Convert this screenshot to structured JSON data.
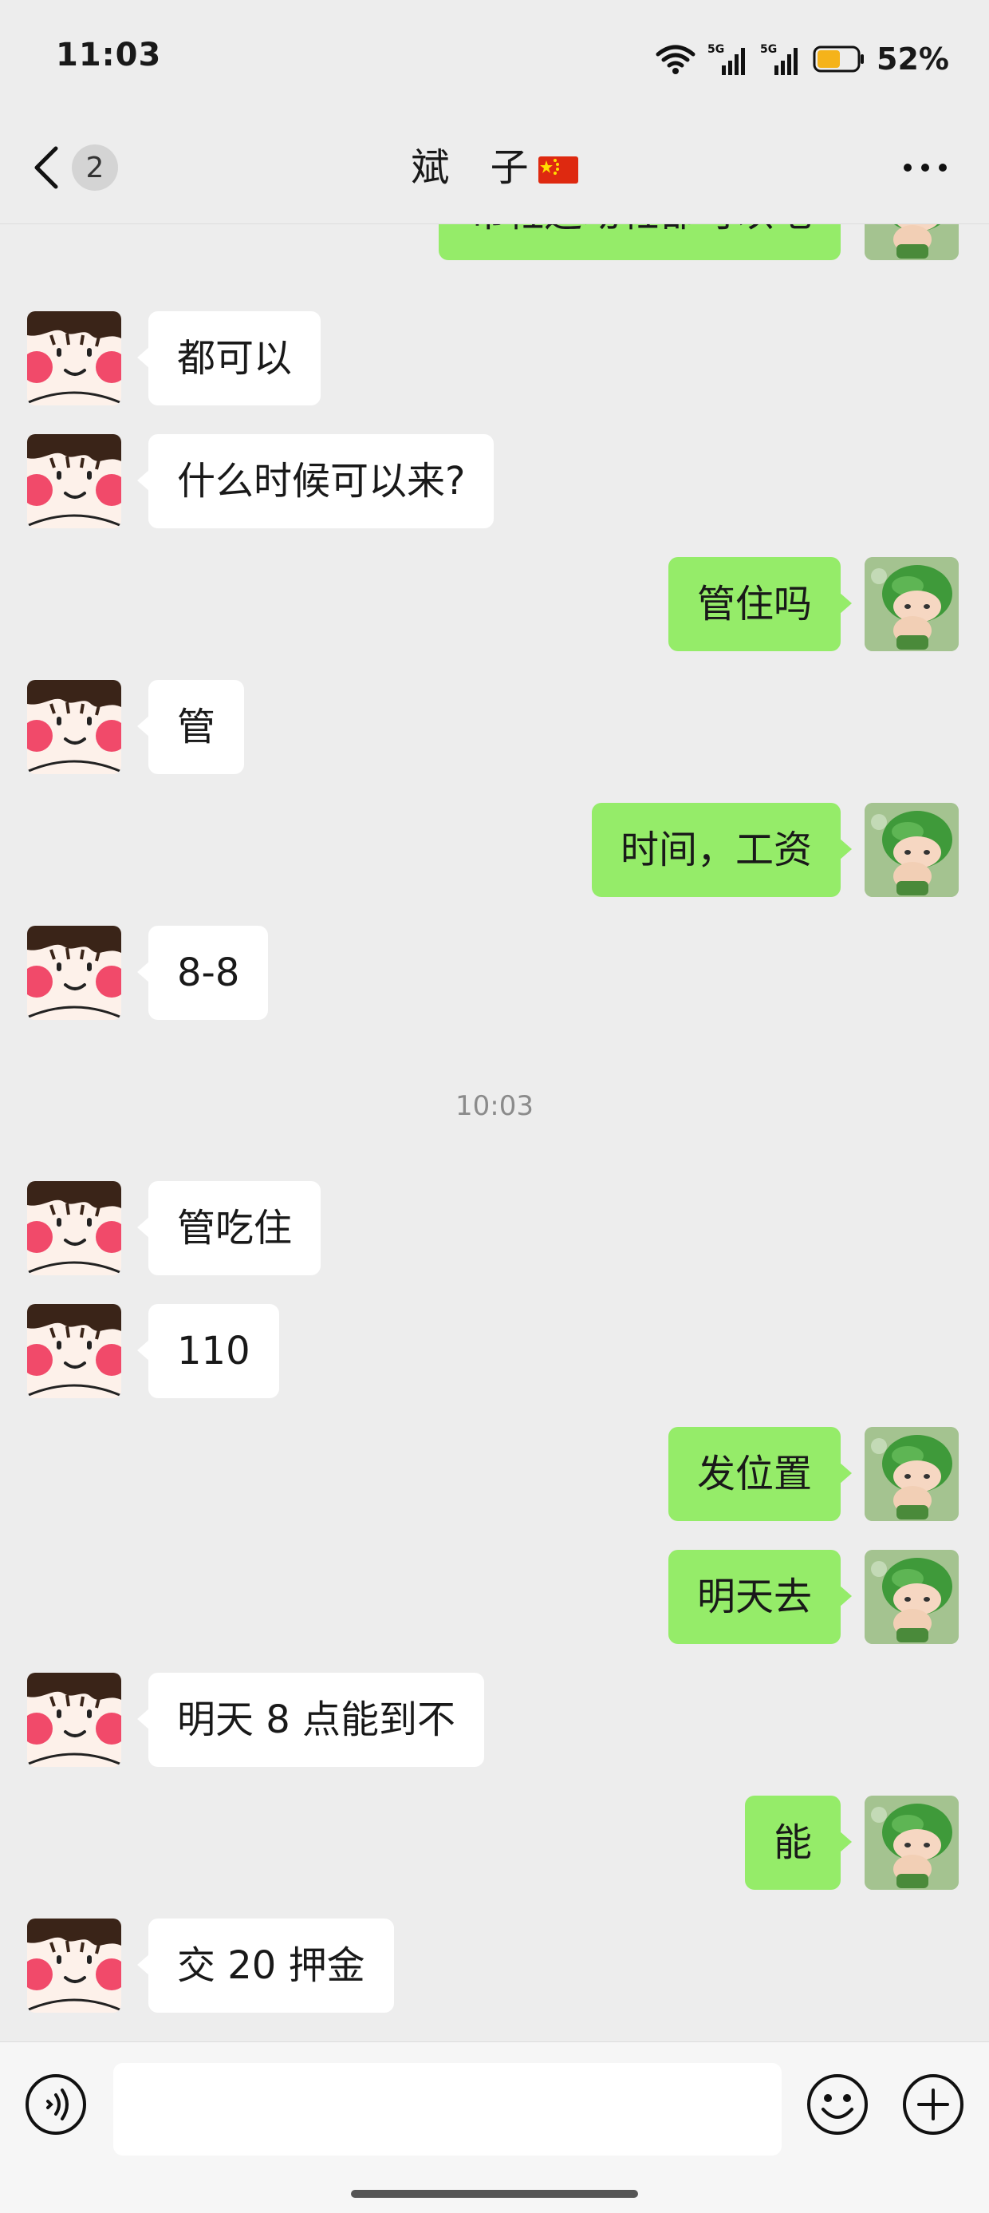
{
  "status_bar": {
    "time": "11:03",
    "battery": "52%",
    "network": "5G"
  },
  "header": {
    "unread_count": "2",
    "contact_name": "斌 子"
  },
  "messages": [
    {
      "side": "right",
      "text": "布鞋运动鞋都可以吧"
    },
    {
      "side": "left",
      "text": "都可以"
    },
    {
      "side": "left",
      "text": "什么时候可以来?"
    },
    {
      "side": "right",
      "text": "管住吗"
    },
    {
      "side": "left",
      "text": "管"
    },
    {
      "side": "right",
      "text": "时间，工资"
    },
    {
      "side": "left",
      "text": "8-8"
    },
    {
      "side": "left",
      "text": "管吃住"
    },
    {
      "side": "left",
      "text": "110"
    },
    {
      "side": "right",
      "text": "发位置"
    },
    {
      "side": "right",
      "text": "明天去"
    },
    {
      "side": "left",
      "text": "明天 8 点能到不"
    },
    {
      "side": "right",
      "text": "能"
    },
    {
      "side": "left",
      "text": "交 20 押金"
    }
  ],
  "timestamp": "10:03",
  "input": {
    "value": "",
    "placeholder": ""
  },
  "icons": {
    "back": "chevron-left-icon",
    "more": "more-dots-icon",
    "voice": "voice-icon",
    "emoji": "emoji-icon",
    "plus": "plus-icon"
  },
  "colors": {
    "background": "#ededed",
    "sent_bubble": "#95ec69",
    "received_bubble": "#ffffff",
    "battery": "#f5b31a"
  }
}
